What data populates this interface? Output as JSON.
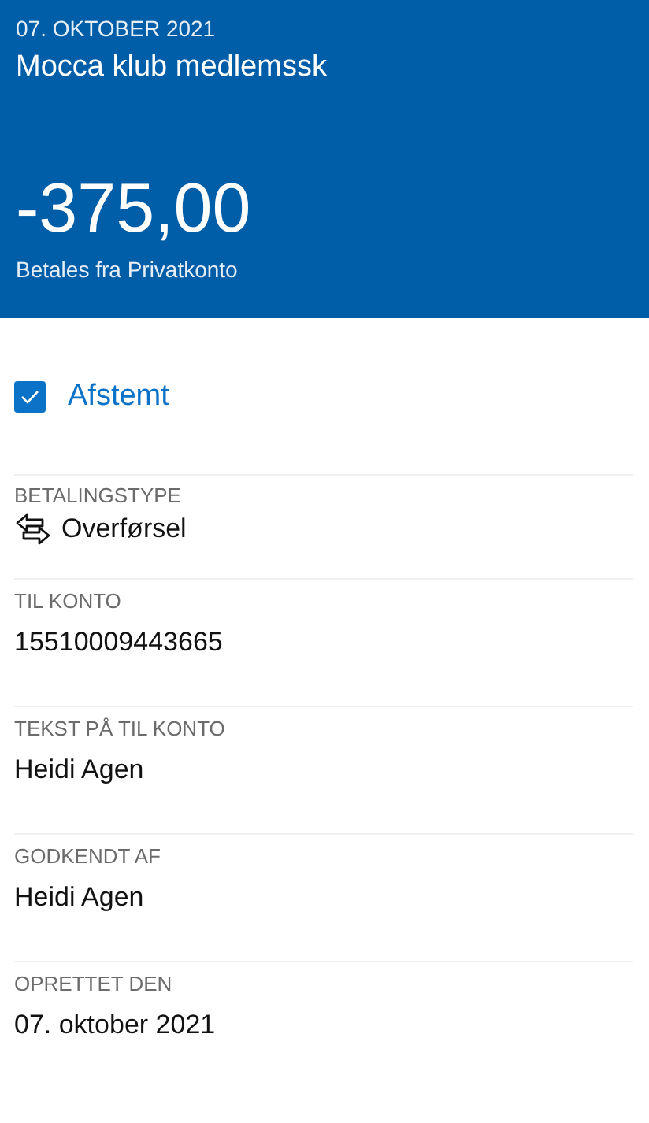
{
  "header": {
    "date": "07. OKTOBER 2021",
    "title": "Mocca klub medlemssk",
    "amount": "-375,00",
    "source": "Betales fra Privatkonto"
  },
  "reconciled": {
    "label": "Afstemt",
    "checked": true
  },
  "fields": [
    {
      "kind": "icon",
      "label": "BETALINGSTYPE",
      "value": "Overførsel"
    },
    {
      "kind": "text",
      "label": "TIL KONTO",
      "value": "15510009443665"
    },
    {
      "kind": "text",
      "label": "TEKST PÅ TIL KONTO",
      "value": "Heidi Agen"
    },
    {
      "kind": "text",
      "label": "GODKENDT AF",
      "value": "Heidi Agen"
    },
    {
      "kind": "text",
      "label": "OPRETTET DEN",
      "value": "07. oktober 2021"
    }
  ]
}
